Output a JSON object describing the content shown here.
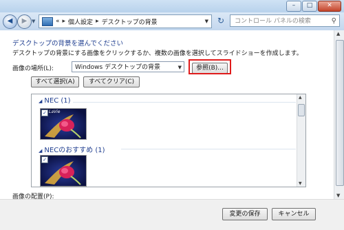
{
  "window": {
    "minimize": "–",
    "maximize": "□",
    "close": "✕"
  },
  "address": {
    "part1": "個人設定",
    "part2": "デスクトップの背景"
  },
  "search": {
    "placeholder": "コントロール パネルの検索"
  },
  "page": {
    "heading": "デスクトップの背景を選んでください",
    "description": "デスクトップの背景にする画像をクリックするか、複数の画像を選択してスライドショーを作成します。",
    "location_label": "画像の場所(L):",
    "location_value": "Windows デスクトップの背景",
    "browse_label": "参照(B)...",
    "select_all_label": "すべて選択(A)",
    "clear_all_label": "すべてクリア(C)",
    "position_label": "画像の配置(P):"
  },
  "gallery": {
    "groups": [
      {
        "title": "NEC (1)",
        "thumb_caption": "LaVie"
      },
      {
        "title": "NECのおすすめ (1)"
      }
    ]
  },
  "footer": {
    "save_label": "変更の保存",
    "cancel_label": "キャンセル"
  },
  "colors": {
    "highlight": "#e01b1b",
    "link": "#1e3d8f"
  }
}
